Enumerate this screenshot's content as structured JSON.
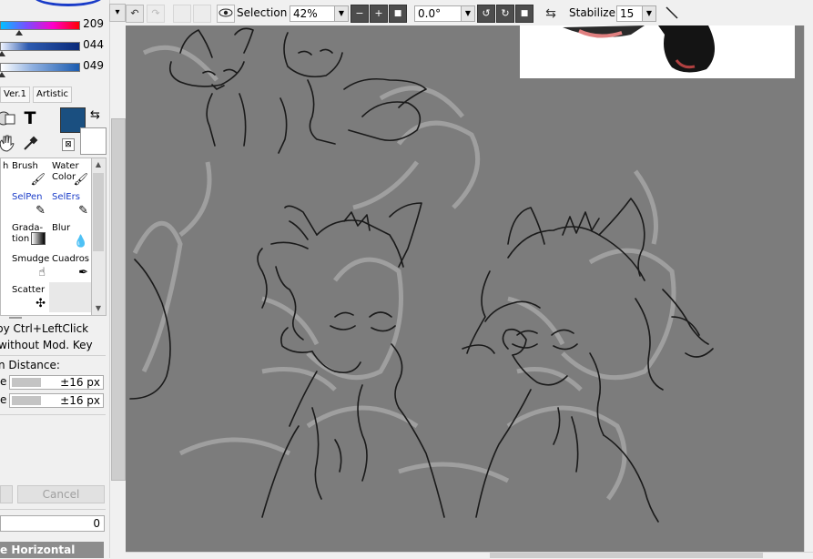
{
  "color_panel": {
    "sliders": [
      {
        "value": "209",
        "gradient": [
          "#00e5ff",
          "#ff0000"
        ],
        "level": 0.15
      },
      {
        "value": "044",
        "gradient": [
          "#e8f0ff",
          "#003b8a"
        ],
        "level": 0.01
      },
      {
        "value": "049",
        "gradient": [
          "#ffffff",
          "#1b5cb0"
        ],
        "level": 0.01
      }
    ],
    "tabs": [
      "Ver.1",
      "Artistic"
    ],
    "main_color": "#1a4f80",
    "sub_color": "#ffffff"
  },
  "tools": [
    {
      "label": "h",
      "icon": "brush-partial-icon"
    },
    {
      "label": "Brush",
      "icon": "brush-icon"
    },
    {
      "label": "Water Color",
      "icon": "watercolor-icon"
    },
    {
      "label": "",
      "icon": ""
    },
    {
      "label": "SelPen",
      "icon": "selpen-icon"
    },
    {
      "label": "SelErs",
      "icon": "selers-icon"
    },
    {
      "label": "Grada-tion",
      "icon": "gradation-icon"
    },
    {
      "label": "Blur",
      "icon": "blur-icon"
    },
    {
      "label": "Smudge",
      "icon": "smudge-icon"
    },
    {
      "label": "Cuadros",
      "icon": "pen-icon"
    },
    {
      "label": "Scatter",
      "icon": "scatter-icon"
    }
  ],
  "options": {
    "line1": "by Ctrl+LeftClick",
    "line2": "without Mod. Key",
    "distance_label": "n Distance:",
    "size_rows": [
      {
        "label": "e",
        "value": "±16 px"
      },
      {
        "label": "e",
        "value": "±16 px"
      }
    ],
    "cancel_label": "Cancel",
    "number_value": "0",
    "panel_header": "e Horizontal"
  },
  "toolbar": {
    "selection_label": "Selection",
    "zoom": "42%",
    "rotation": "0.0°",
    "stabilizer_label": "Stabilizer",
    "stabilizer_value": "15"
  },
  "colors": {
    "canvas_bg": "#7c7c7c",
    "line_art": "#1a1a1a",
    "panel_bg": "#f0f0f0"
  }
}
